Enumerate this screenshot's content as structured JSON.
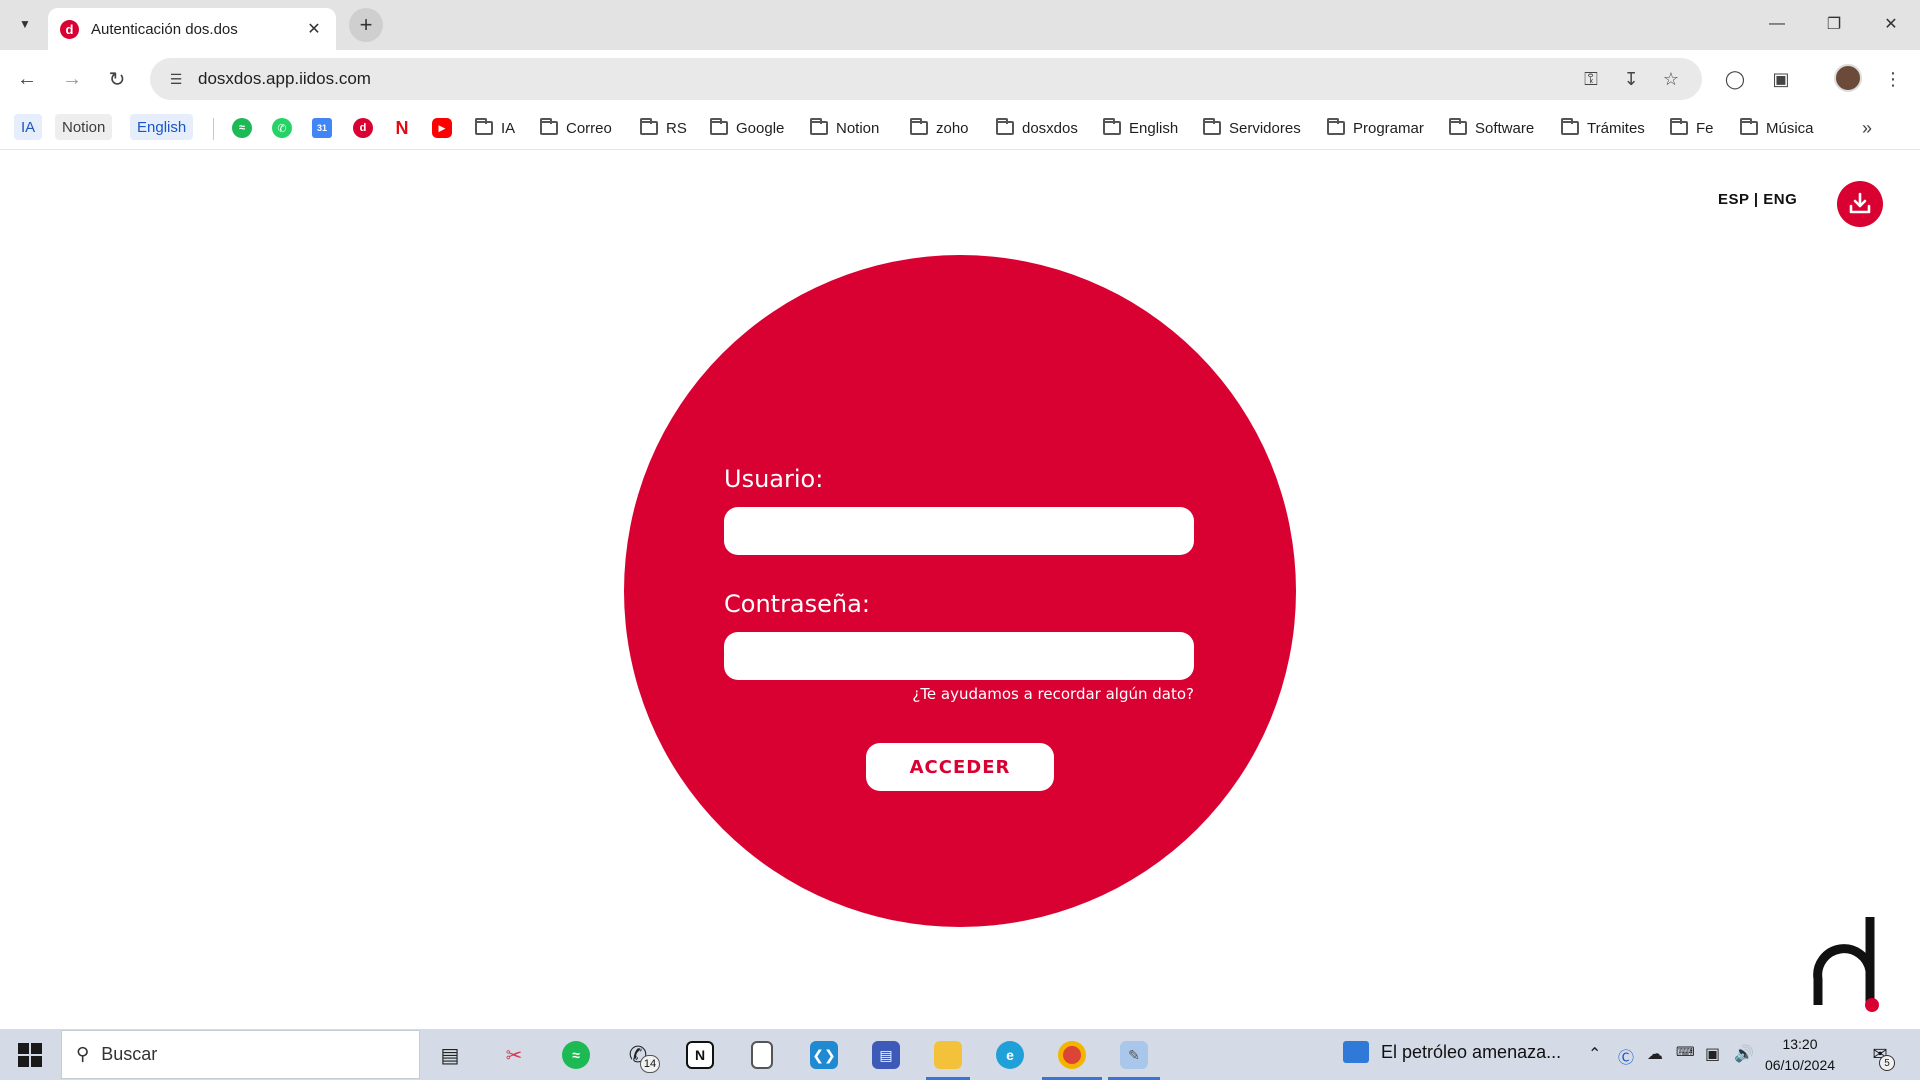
{
  "browser": {
    "tab_title": "Autenticación dos.dos",
    "url": "dosxdos.app.iidos.com",
    "bookmarks": {
      "pills": [
        "IA",
        "Notion",
        "English"
      ],
      "folders": [
        "IA",
        "Correo",
        "RS",
        "Google",
        "Notion",
        "zoho",
        "dosxdos",
        "English",
        "Servidores",
        "Programar",
        "Software",
        "Trámites",
        "Fe",
        "Música"
      ]
    }
  },
  "page": {
    "lang_esp": "ESP",
    "lang_sep": "|",
    "lang_eng": "ENG",
    "usuario_label": "Usuario:",
    "usuario_value": "",
    "password_label": "Contraseña:",
    "password_value": "",
    "forgot_link": "¿Te ayudamos a recordar algún dato?",
    "submit_label": "ACCEDER"
  },
  "colors": {
    "brand_red": "#d90032",
    "background": "#ffffff"
  },
  "taskbar": {
    "search_placeholder": "Buscar",
    "whatsapp_badge": "14",
    "news_text": "El petróleo amenaza...",
    "time": "13:20",
    "date": "06/10/2024",
    "notification_count": "5"
  }
}
